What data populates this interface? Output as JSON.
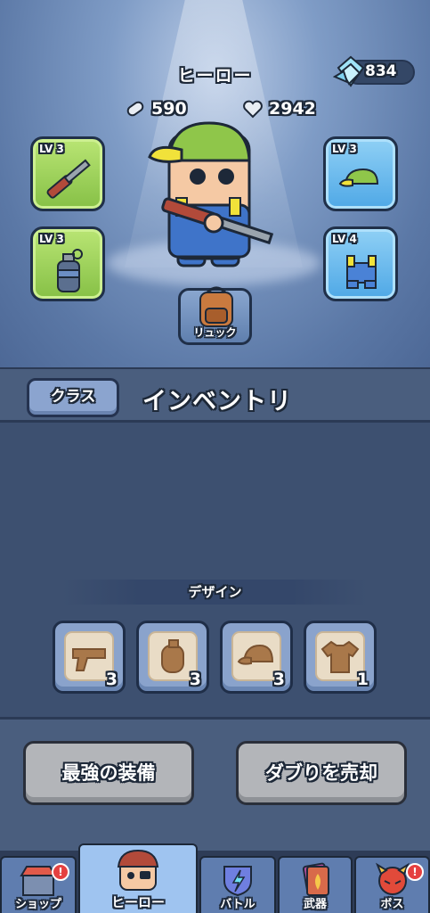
{
  "header": {
    "title": "ヒーロー",
    "gems": "834",
    "ammo": "590",
    "health": "2942"
  },
  "equipment": {
    "left": [
      {
        "level": "LV 3",
        "item": "shotgun-icon"
      },
      {
        "level": "LV 3",
        "item": "grenade-icon"
      }
    ],
    "right": [
      {
        "level": "LV 3",
        "item": "cap-icon"
      },
      {
        "level": "LV 4",
        "item": "overalls-icon"
      }
    ],
    "backpack_label": "リュック"
  },
  "tabs": {
    "class_label": "クラス",
    "inventory_title": "インベントリ"
  },
  "design": {
    "header": "デザイン",
    "items": [
      {
        "icon": "gun-design-icon",
        "count": "3"
      },
      {
        "icon": "grenade-design-icon",
        "count": "3"
      },
      {
        "icon": "cap-design-icon",
        "count": "3"
      },
      {
        "icon": "shirt-design-icon",
        "count": "1"
      }
    ]
  },
  "actions": {
    "best_gear": "最強の装備",
    "sell_duplicates": "ダブりを売却"
  },
  "nav": {
    "shop": "ショップ",
    "hero": "ヒーロー",
    "battle": "バトル",
    "weapons": "武器",
    "boss": "ボス",
    "alert_mark": "!"
  },
  "colors": {
    "green_slot": "#86c046",
    "blue_slot": "#4fa8e6",
    "background": "#3d5070"
  }
}
